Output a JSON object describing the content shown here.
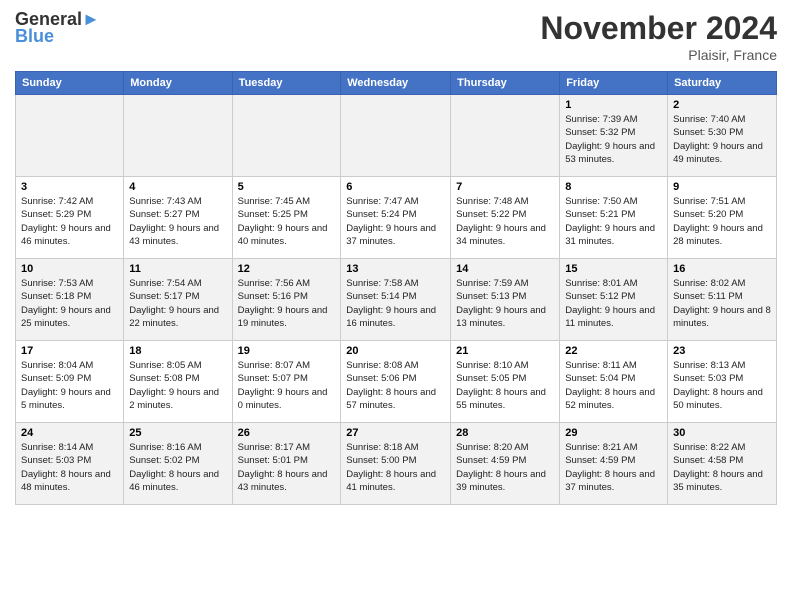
{
  "header": {
    "logo_line1": "General",
    "logo_line2": "Blue",
    "month": "November 2024",
    "location": "Plaisir, France"
  },
  "days_of_week": [
    "Sunday",
    "Monday",
    "Tuesday",
    "Wednesday",
    "Thursday",
    "Friday",
    "Saturday"
  ],
  "weeks": [
    [
      {
        "num": "",
        "info": ""
      },
      {
        "num": "",
        "info": ""
      },
      {
        "num": "",
        "info": ""
      },
      {
        "num": "",
        "info": ""
      },
      {
        "num": "",
        "info": ""
      },
      {
        "num": "1",
        "info": "Sunrise: 7:39 AM\nSunset: 5:32 PM\nDaylight: 9 hours and 53 minutes."
      },
      {
        "num": "2",
        "info": "Sunrise: 7:40 AM\nSunset: 5:30 PM\nDaylight: 9 hours and 49 minutes."
      }
    ],
    [
      {
        "num": "3",
        "info": "Sunrise: 7:42 AM\nSunset: 5:29 PM\nDaylight: 9 hours and 46 minutes."
      },
      {
        "num": "4",
        "info": "Sunrise: 7:43 AM\nSunset: 5:27 PM\nDaylight: 9 hours and 43 minutes."
      },
      {
        "num": "5",
        "info": "Sunrise: 7:45 AM\nSunset: 5:25 PM\nDaylight: 9 hours and 40 minutes."
      },
      {
        "num": "6",
        "info": "Sunrise: 7:47 AM\nSunset: 5:24 PM\nDaylight: 9 hours and 37 minutes."
      },
      {
        "num": "7",
        "info": "Sunrise: 7:48 AM\nSunset: 5:22 PM\nDaylight: 9 hours and 34 minutes."
      },
      {
        "num": "8",
        "info": "Sunrise: 7:50 AM\nSunset: 5:21 PM\nDaylight: 9 hours and 31 minutes."
      },
      {
        "num": "9",
        "info": "Sunrise: 7:51 AM\nSunset: 5:20 PM\nDaylight: 9 hours and 28 minutes."
      }
    ],
    [
      {
        "num": "10",
        "info": "Sunrise: 7:53 AM\nSunset: 5:18 PM\nDaylight: 9 hours and 25 minutes."
      },
      {
        "num": "11",
        "info": "Sunrise: 7:54 AM\nSunset: 5:17 PM\nDaylight: 9 hours and 22 minutes."
      },
      {
        "num": "12",
        "info": "Sunrise: 7:56 AM\nSunset: 5:16 PM\nDaylight: 9 hours and 19 minutes."
      },
      {
        "num": "13",
        "info": "Sunrise: 7:58 AM\nSunset: 5:14 PM\nDaylight: 9 hours and 16 minutes."
      },
      {
        "num": "14",
        "info": "Sunrise: 7:59 AM\nSunset: 5:13 PM\nDaylight: 9 hours and 13 minutes."
      },
      {
        "num": "15",
        "info": "Sunrise: 8:01 AM\nSunset: 5:12 PM\nDaylight: 9 hours and 11 minutes."
      },
      {
        "num": "16",
        "info": "Sunrise: 8:02 AM\nSunset: 5:11 PM\nDaylight: 9 hours and 8 minutes."
      }
    ],
    [
      {
        "num": "17",
        "info": "Sunrise: 8:04 AM\nSunset: 5:09 PM\nDaylight: 9 hours and 5 minutes."
      },
      {
        "num": "18",
        "info": "Sunrise: 8:05 AM\nSunset: 5:08 PM\nDaylight: 9 hours and 2 minutes."
      },
      {
        "num": "19",
        "info": "Sunrise: 8:07 AM\nSunset: 5:07 PM\nDaylight: 9 hours and 0 minutes."
      },
      {
        "num": "20",
        "info": "Sunrise: 8:08 AM\nSunset: 5:06 PM\nDaylight: 8 hours and 57 minutes."
      },
      {
        "num": "21",
        "info": "Sunrise: 8:10 AM\nSunset: 5:05 PM\nDaylight: 8 hours and 55 minutes."
      },
      {
        "num": "22",
        "info": "Sunrise: 8:11 AM\nSunset: 5:04 PM\nDaylight: 8 hours and 52 minutes."
      },
      {
        "num": "23",
        "info": "Sunrise: 8:13 AM\nSunset: 5:03 PM\nDaylight: 8 hours and 50 minutes."
      }
    ],
    [
      {
        "num": "24",
        "info": "Sunrise: 8:14 AM\nSunset: 5:03 PM\nDaylight: 8 hours and 48 minutes."
      },
      {
        "num": "25",
        "info": "Sunrise: 8:16 AM\nSunset: 5:02 PM\nDaylight: 8 hours and 46 minutes."
      },
      {
        "num": "26",
        "info": "Sunrise: 8:17 AM\nSunset: 5:01 PM\nDaylight: 8 hours and 43 minutes."
      },
      {
        "num": "27",
        "info": "Sunrise: 8:18 AM\nSunset: 5:00 PM\nDaylight: 8 hours and 41 minutes."
      },
      {
        "num": "28",
        "info": "Sunrise: 8:20 AM\nSunset: 4:59 PM\nDaylight: 8 hours and 39 minutes."
      },
      {
        "num": "29",
        "info": "Sunrise: 8:21 AM\nSunset: 4:59 PM\nDaylight: 8 hours and 37 minutes."
      },
      {
        "num": "30",
        "info": "Sunrise: 8:22 AM\nSunset: 4:58 PM\nDaylight: 8 hours and 35 minutes."
      }
    ]
  ]
}
